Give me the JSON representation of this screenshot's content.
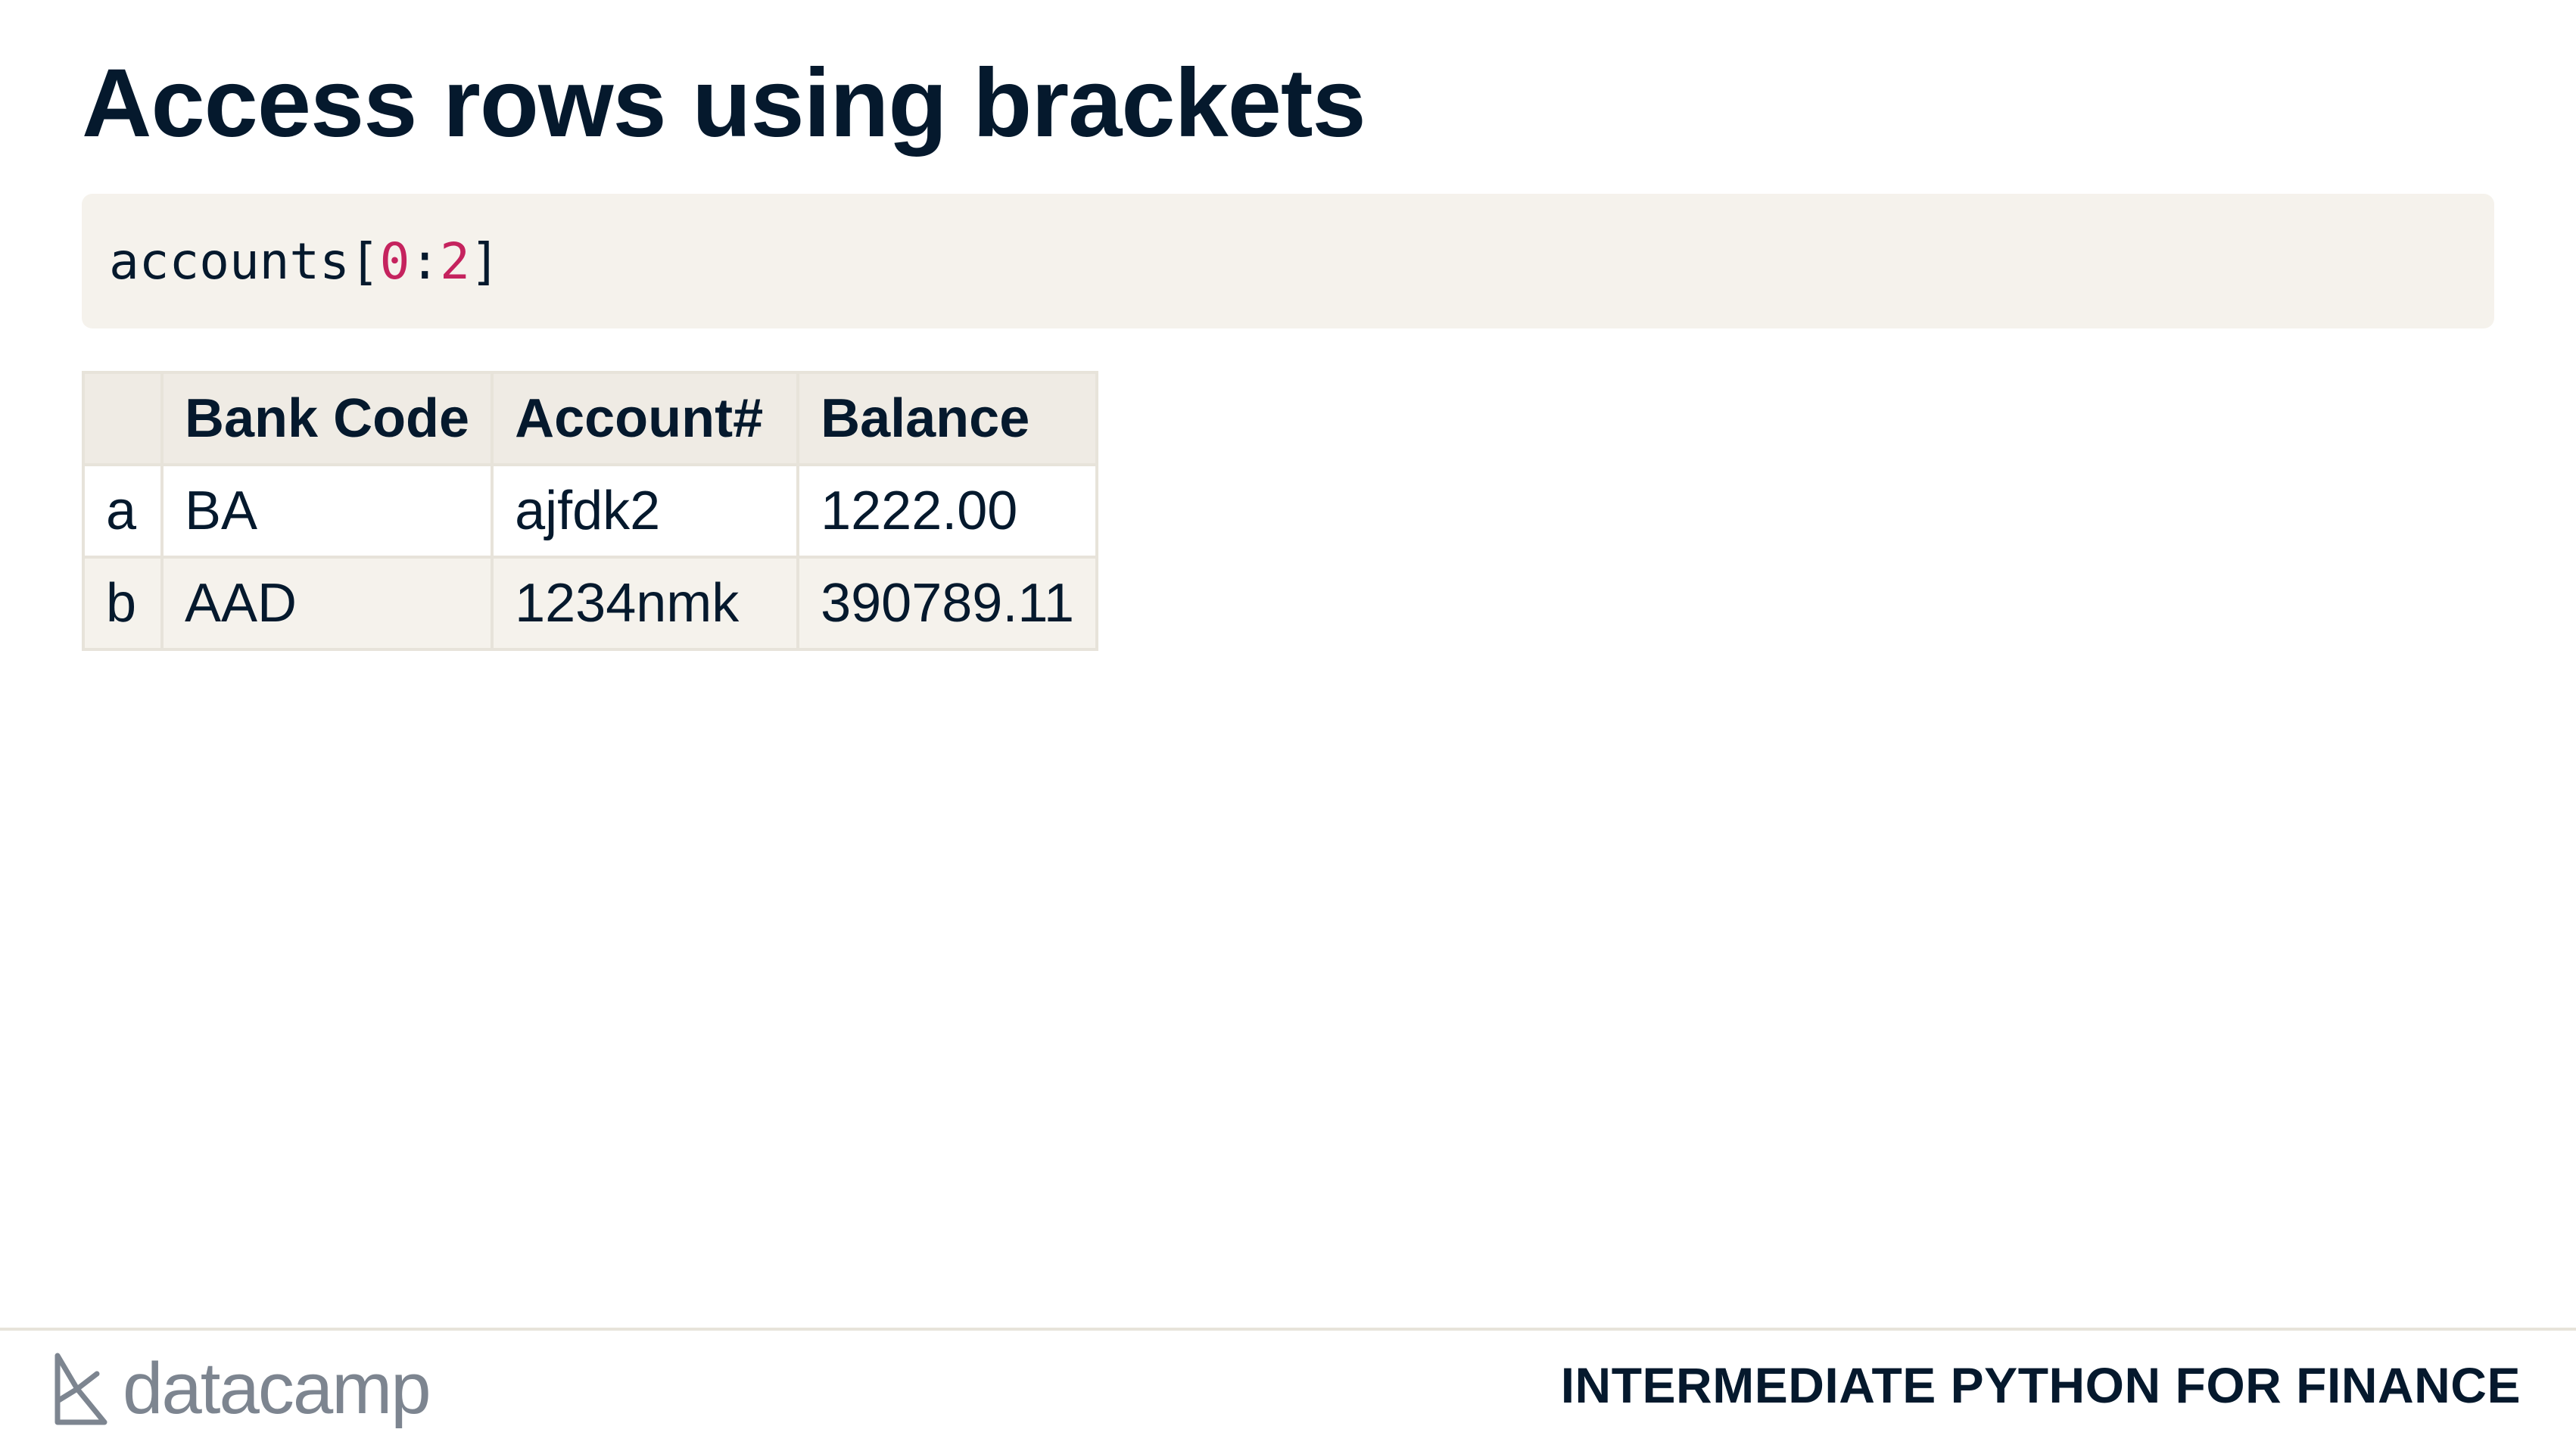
{
  "slide": {
    "title": "Access rows using brackets",
    "code": {
      "prefix": "accounts[",
      "start": "0",
      "sep": ":",
      "stop": "2",
      "suffix": "]"
    },
    "table": {
      "columns": [
        "",
        "Bank Code",
        "Account#",
        "Balance"
      ],
      "rows": [
        {
          "index": "a",
          "bank_code": "BA",
          "account": "ajfdk2",
          "balance": "1222.00"
        },
        {
          "index": "b",
          "bank_code": "AAD",
          "account": "1234nmk",
          "balance": "390789.11"
        }
      ]
    }
  },
  "footer": {
    "logo_text": "datacamp",
    "logo_icon": "datacamp-logo-icon",
    "course_name": "INTERMEDIATE PYTHON FOR FINANCE"
  },
  "colors": {
    "text": "#05192d",
    "code_bg": "#f5f2ec",
    "code_number": "#c5235e",
    "table_header_bg": "#efebe4",
    "table_border": "#e7e3da",
    "logo_gray": "#7d8590"
  }
}
